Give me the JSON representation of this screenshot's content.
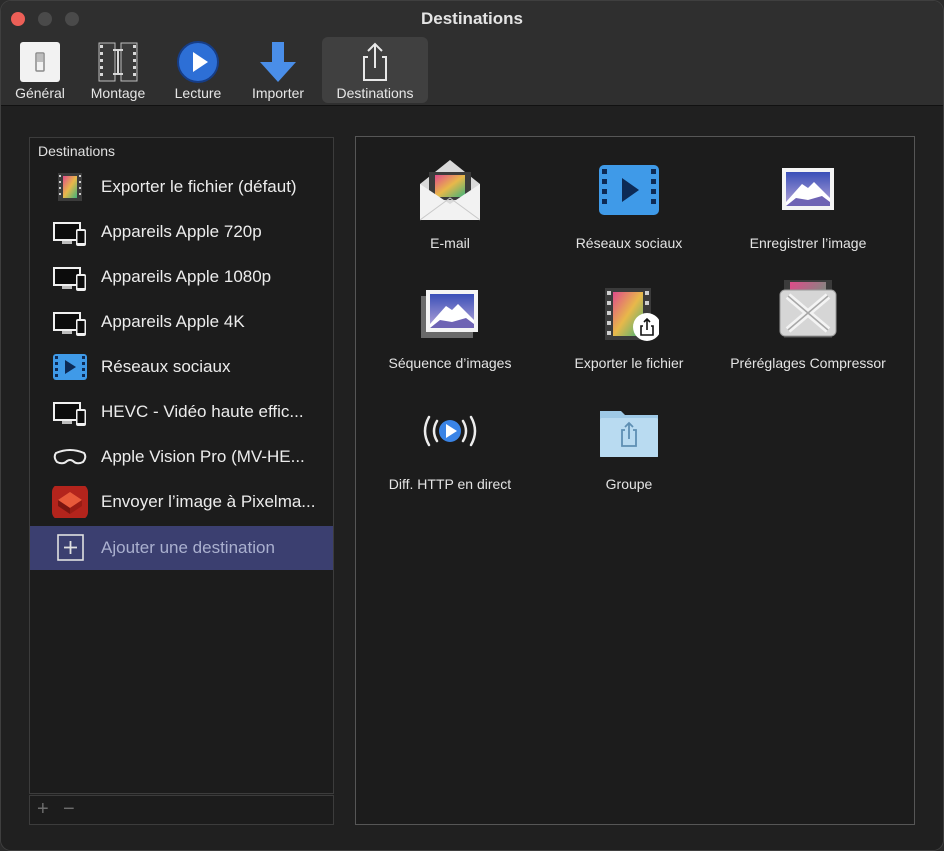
{
  "window": {
    "title": "Destinations"
  },
  "toolbar": {
    "items": [
      {
        "label": "Général",
        "icon": "switch-icon"
      },
      {
        "label": "Montage",
        "icon": "film-strip-icon"
      },
      {
        "label": "Lecture",
        "icon": "play-icon"
      },
      {
        "label": "Importer",
        "icon": "download-arrow-icon"
      },
      {
        "label": "Destinations",
        "icon": "share-icon",
        "selected": true
      }
    ]
  },
  "sidebar": {
    "header": "Destinations",
    "items": [
      {
        "label": "Exporter le fichier (défaut)",
        "icon": "film-frame-icon"
      },
      {
        "label": "Appareils Apple 720p",
        "icon": "apple-devices-icon"
      },
      {
        "label": "Appareils Apple 1080p",
        "icon": "apple-devices-icon"
      },
      {
        "label": "Appareils Apple 4K",
        "icon": "apple-devices-icon"
      },
      {
        "label": "Réseaux sociaux",
        "icon": "social-video-icon"
      },
      {
        "label": "HEVC - Vidéo haute effic...",
        "icon": "apple-devices-icon"
      },
      {
        "label": "Apple Vision Pro (MV-HE...",
        "icon": "vision-pro-icon"
      },
      {
        "label": "Envoyer l’image à Pixelma...",
        "icon": "pixelmator-icon"
      },
      {
        "label": "Ajouter une destination",
        "icon": "add-box-icon",
        "selected": true
      }
    ],
    "footer": {
      "add": "+",
      "remove": "−"
    }
  },
  "gallery": {
    "items": [
      {
        "label": "E-mail",
        "icon": "mail-envelope-icon"
      },
      {
        "label": "Réseaux sociaux",
        "icon": "social-video-icon"
      },
      {
        "label": "Enregistrer l’image",
        "icon": "image-icon"
      },
      {
        "label": "Séquence d’images",
        "icon": "image-stack-icon"
      },
      {
        "label": "Exporter le fichier",
        "icon": "export-file-icon"
      },
      {
        "label": "Préréglages Compressor",
        "icon": "compressor-icon"
      },
      {
        "label": "Diff. HTTP en direct",
        "icon": "live-broadcast-icon"
      },
      {
        "label": "Groupe",
        "icon": "folder-share-icon"
      }
    ]
  },
  "colors": {
    "accent_blue": "#2f7ff0",
    "selection": "#3b3f70",
    "close_button": "#ec5f57"
  }
}
